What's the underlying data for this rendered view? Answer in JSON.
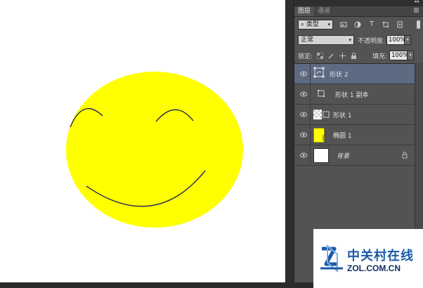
{
  "canvas": {
    "background": "#ffffff",
    "face_color": "#ffff00",
    "stroke_color": "#2a2a55"
  },
  "panel": {
    "collapse_glyph": "◂◂",
    "tabs": [
      {
        "label": "图层",
        "active": true
      },
      {
        "label": "通道",
        "active": false
      }
    ],
    "tab_menu_icon": "panel-menu-icon",
    "filter": {
      "kind_label": "类型",
      "icons": [
        "image-filter-icon",
        "adjustment-filter-icon",
        "type-filter-icon",
        "shape-filter-icon",
        "smart-object-filter-icon"
      ]
    },
    "blend_mode": "正常",
    "opacity_label": "不透明度:",
    "opacity_value": "100%",
    "lock_label": "锁定:",
    "fill_label": "填充:",
    "fill_value": "100%"
  },
  "layers": [
    {
      "name": "形状 2",
      "selected": true,
      "thumb": "shape-vector",
      "italic": false,
      "locked": false
    },
    {
      "name": "形状 1 副本",
      "selected": false,
      "thumb": "shape-vector",
      "italic": false,
      "locked": false
    },
    {
      "name": "形状 1",
      "selected": false,
      "thumb": "transparent-shape",
      "italic": false,
      "locked": false
    },
    {
      "name": "椭圆 1",
      "selected": false,
      "thumb": "yellow-fill",
      "italic": false,
      "locked": false
    },
    {
      "name": "背景",
      "selected": false,
      "thumb": "white-fill",
      "italic": true,
      "locked": true
    }
  ],
  "watermark": {
    "brand": "中关村在线",
    "domain": "ZOL.COM.CN",
    "logo_color": "#1a5aa8"
  }
}
